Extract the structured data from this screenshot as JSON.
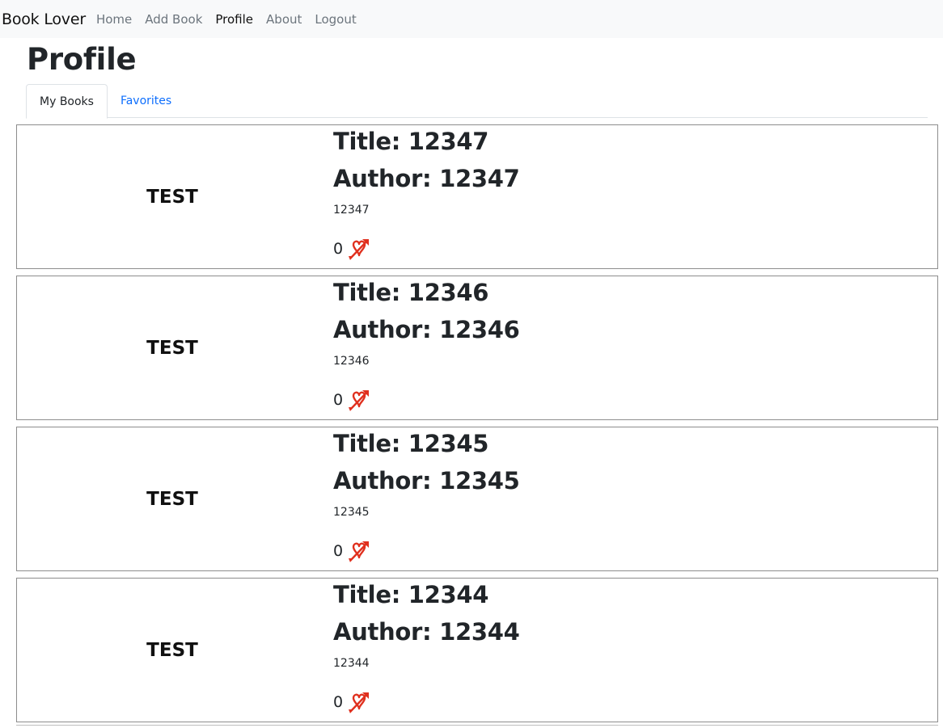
{
  "navbar": {
    "brand": "Book Lover",
    "links": [
      "Home",
      "Add Book",
      "Profile",
      "About",
      "Logout"
    ]
  },
  "page": {
    "title": "Profile"
  },
  "tabs": [
    "My Books",
    "Favorites"
  ],
  "books": [
    {
      "cover": "TEST",
      "title": "Title: 12347",
      "author": "Author: 12347",
      "description": "12347",
      "likes": "0"
    },
    {
      "cover": "TEST",
      "title": "Title: 12346",
      "author": "Author: 12346",
      "description": "12346",
      "likes": "0"
    },
    {
      "cover": "TEST",
      "title": "Title: 12345",
      "author": "Author: 12345",
      "description": "12345",
      "likes": "0"
    },
    {
      "cover": "TEST",
      "title": "Title: 12344",
      "author": "Author: 12344",
      "description": "12344",
      "likes": "0"
    }
  ],
  "icons": {
    "like": "heart-arrow-icon"
  },
  "colors": {
    "like_icon": "#e0301e",
    "tab_link": "#0d6efd",
    "navbar_bg": "#f8f9fa"
  }
}
